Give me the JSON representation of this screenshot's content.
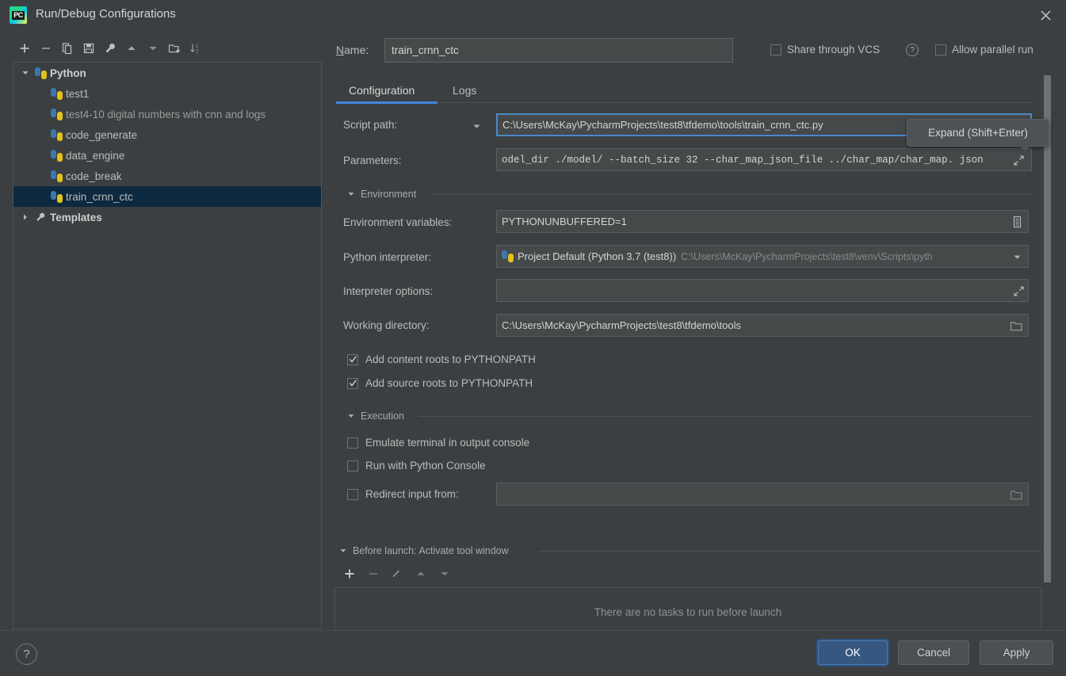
{
  "window": {
    "title": "Run/Debug Configurations",
    "app_icon": "pycharm-logo-icon",
    "close_icon": "close-icon"
  },
  "left_toolbar": {
    "buttons": [
      {
        "name": "add-configuration-button",
        "icon": "plus-icon"
      },
      {
        "name": "remove-configuration-button",
        "icon": "minus-icon"
      },
      {
        "name": "copy-configuration-button",
        "icon": "copy-icon"
      },
      {
        "name": "save-configuration-button",
        "icon": "save-icon"
      },
      {
        "name": "edit-templates-button",
        "icon": "wrench-icon"
      },
      {
        "name": "move-up-button",
        "icon": "arrow-up-icon"
      },
      {
        "name": "move-down-button",
        "icon": "arrow-down-icon"
      },
      {
        "name": "new-folder-button",
        "icon": "new-folder-icon"
      },
      {
        "name": "sort-configurations-button",
        "icon": "sort-az-icon"
      }
    ]
  },
  "tree": {
    "nodes": [
      {
        "label": "Python",
        "type": "group",
        "expanded": true,
        "icon": "python-icon",
        "selected": false
      },
      {
        "label": "test1",
        "type": "child",
        "icon": "python-icon",
        "selected": false
      },
      {
        "label": "test4-10 digital numbers with cnn and logs",
        "type": "child",
        "icon": "python-icon",
        "selected": false,
        "dim": true
      },
      {
        "label": "code_generate",
        "type": "child",
        "icon": "python-icon",
        "selected": false
      },
      {
        "label": "data_engine",
        "type": "child",
        "icon": "python-icon",
        "selected": false
      },
      {
        "label": "code_break",
        "type": "child",
        "icon": "python-icon",
        "selected": false
      },
      {
        "label": "train_crnn_ctc",
        "type": "child",
        "icon": "python-icon",
        "selected": true
      },
      {
        "label": "Templates",
        "type": "group",
        "expanded": false,
        "icon": "wrench-icon",
        "selected": false
      }
    ]
  },
  "header": {
    "name_label": "Name:",
    "name_value": "train_crnn_ctc",
    "share_vcs_label": "Share through VCS",
    "share_vcs_checked": false,
    "help_icon": "question-mark-icon",
    "allow_parallel_label": "Allow parallel run",
    "allow_parallel_checked": false
  },
  "tabs": [
    {
      "label": "Configuration",
      "active": true,
      "name": "tab-configuration"
    },
    {
      "label": "Logs",
      "active": false,
      "name": "tab-logs"
    }
  ],
  "fields": {
    "script_path_label": "Script path:",
    "script_path_value": "C:\\Users\\McKay\\PycharmProjects\\test8\\tfdemo\\tools\\train_crnn_ctc.py",
    "script_path_dropdown_icon": "chevron-down-icon",
    "parameters_label": "Parameters:",
    "parameters_value": "odel_dir ./model/ --batch_size 32 --char_map_json_file ../char_map/char_map. json",
    "parameters_expand_icon": "expand-icon",
    "environment_section": "Environment",
    "env_vars_label": "Environment variables:",
    "env_vars_value": "PYTHONUNBUFFERED=1",
    "env_vars_icon": "edit-list-icon",
    "interpreter_label": "Python interpreter:",
    "interpreter_value": "Project Default (Python 3.7 (test8))",
    "interpreter_path_hint": "C:\\Users\\McKay\\PycharmProjects\\test8\\venv\\Scripts\\pyth",
    "interpreter_icon": "python-icon",
    "interpreter_dropdown_icon": "chevron-down-icon",
    "interpreter_options_label": "Interpreter options:",
    "interpreter_options_value": "",
    "interpreter_options_expand_icon": "expand-icon",
    "working_dir_label": "Working directory:",
    "working_dir_value": "C:\\Users\\McKay\\PycharmProjects\\test8\\tfdemo\\tools",
    "working_dir_browse_icon": "folder-icon"
  },
  "checkboxes": {
    "add_content_roots": {
      "label": "Add content roots to PYTHONPATH",
      "checked": true
    },
    "add_source_roots": {
      "label": "Add source roots to PYTHONPATH",
      "checked": true
    },
    "emulate_terminal": {
      "label": "Emulate terminal in output console",
      "checked": false
    },
    "run_with_console": {
      "label": "Run with Python Console",
      "checked": false
    },
    "redirect_input": {
      "label": "Redirect input from:",
      "checked": false,
      "value": "",
      "browse_icon": "folder-icon"
    }
  },
  "execution_section": "Execution",
  "before_launch": {
    "header": "Before launch: Activate tool window",
    "empty_text": "There are no tasks to run before launch",
    "toolbar": [
      {
        "name": "before-launch-add-button",
        "icon": "plus-icon",
        "enabled": true
      },
      {
        "name": "before-launch-remove-button",
        "icon": "minus-icon",
        "enabled": false
      },
      {
        "name": "before-launch-edit-button",
        "icon": "pencil-icon",
        "enabled": false
      },
      {
        "name": "before-launch-move-up-button",
        "icon": "arrow-up-icon",
        "enabled": false
      },
      {
        "name": "before-launch-move-down-button",
        "icon": "arrow-down-icon",
        "enabled": false
      }
    ]
  },
  "tooltip": {
    "text": "Expand (Shift+Enter)"
  },
  "buttons": {
    "help": "?",
    "ok": "OK",
    "cancel": "Cancel",
    "apply": "Apply"
  },
  "colors": {
    "background": "#3c3f41",
    "field_bg": "#45494a",
    "accent": "#3d87d8",
    "selection": "#0d293f",
    "primary_button": "#365880",
    "text": "#bbbbbb"
  }
}
